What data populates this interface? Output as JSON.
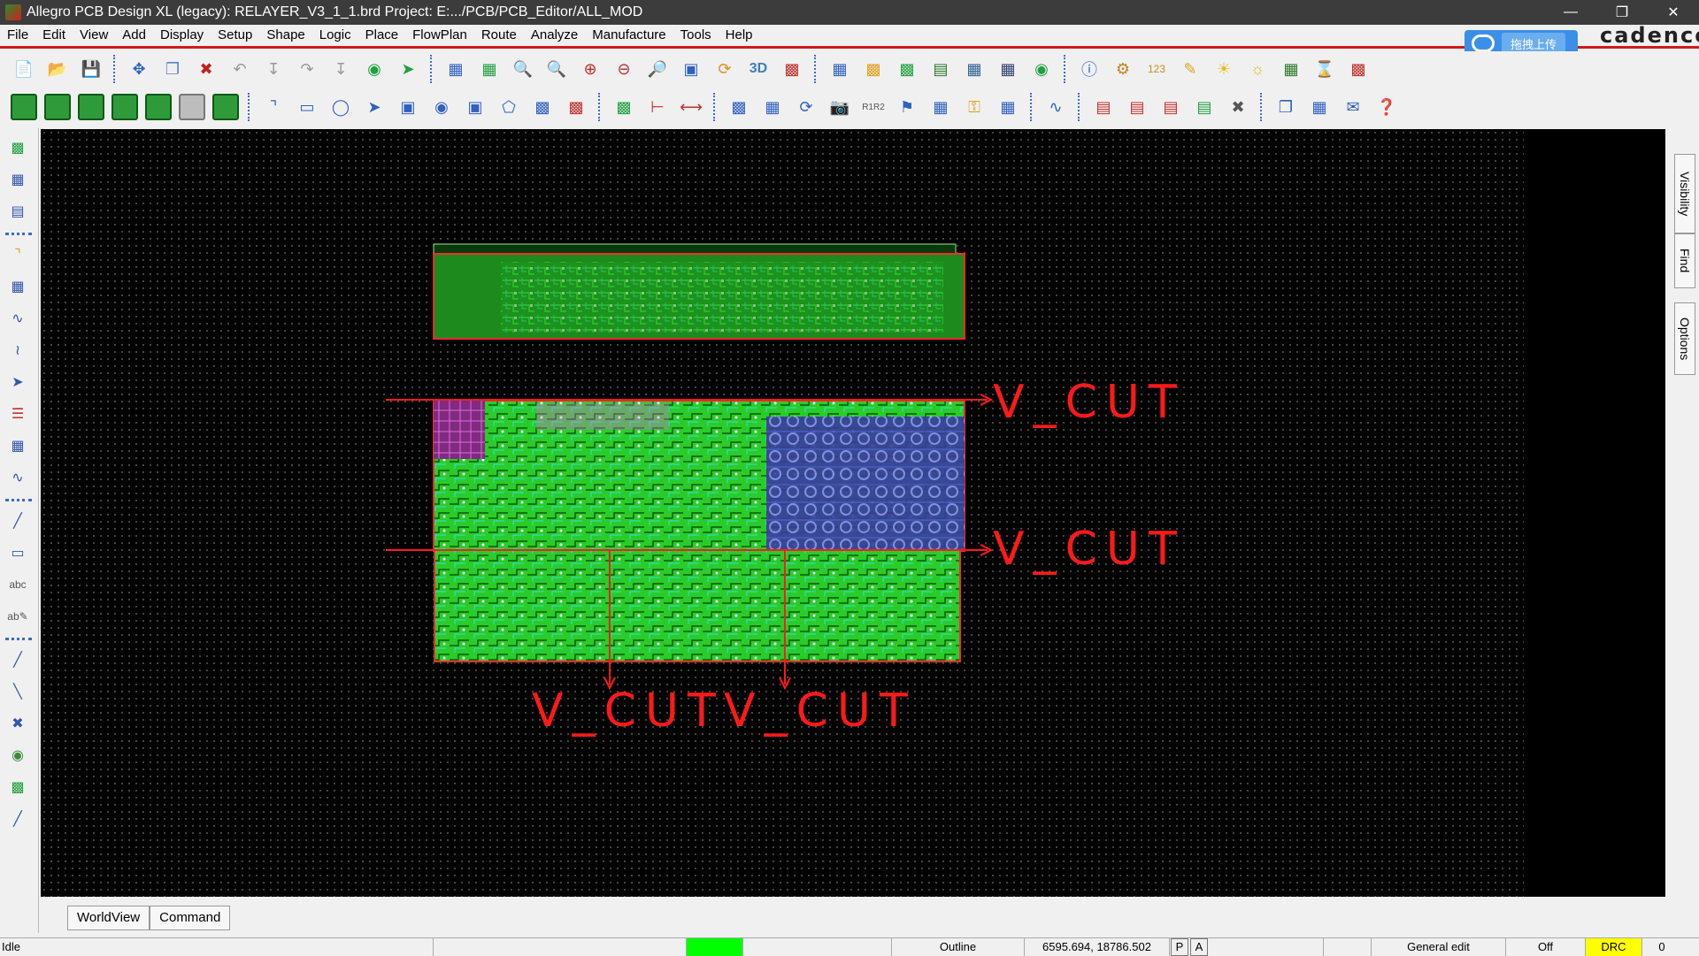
{
  "window": {
    "title": "Allegro PCB Design XL (legacy): RELAYER_V3_1_1.brd  Project: E:.../PCB/PCB_Editor/ALL_MOD",
    "minimize_icon": "minimize-icon",
    "maximize_icon": "restore-icon",
    "close_icon": "close-icon"
  },
  "menu": [
    "File",
    "Edit",
    "View",
    "Add",
    "Display",
    "Setup",
    "Shape",
    "Logic",
    "Place",
    "FlowPlan",
    "Route",
    "Analyze",
    "Manufacture",
    "Tools",
    "Help"
  ],
  "upload_button": {
    "label": "拖拽上传"
  },
  "brand": "cadence",
  "canvas": {
    "cut_labels": [
      "V_CUT",
      "V_CUT",
      "V_CUT",
      "V_CUT"
    ],
    "colors": {
      "cut_line": "#ff1a1a",
      "board_green": "#2fd12f",
      "board_dark_green": "#1f8a1f",
      "blue_region": "#4a4ae0",
      "magenta_region": "#d04ad0",
      "cyan_trace": "#30e0e0"
    }
  },
  "right_tabs": [
    "Visibility",
    "Find",
    "Options"
  ],
  "bottom_tabs": [
    "WorldView",
    "Command"
  ],
  "status": {
    "mode": "Idle",
    "indicator_color": "#00ff00",
    "layer": "Outline",
    "coords": "6595.694, 18786.502",
    "p_flag": "P",
    "a_flag": "A",
    "edit_mode": "General edit",
    "off_label": "Off",
    "drc": "DRC",
    "drc_color": "#ffff00",
    "count": "0"
  }
}
